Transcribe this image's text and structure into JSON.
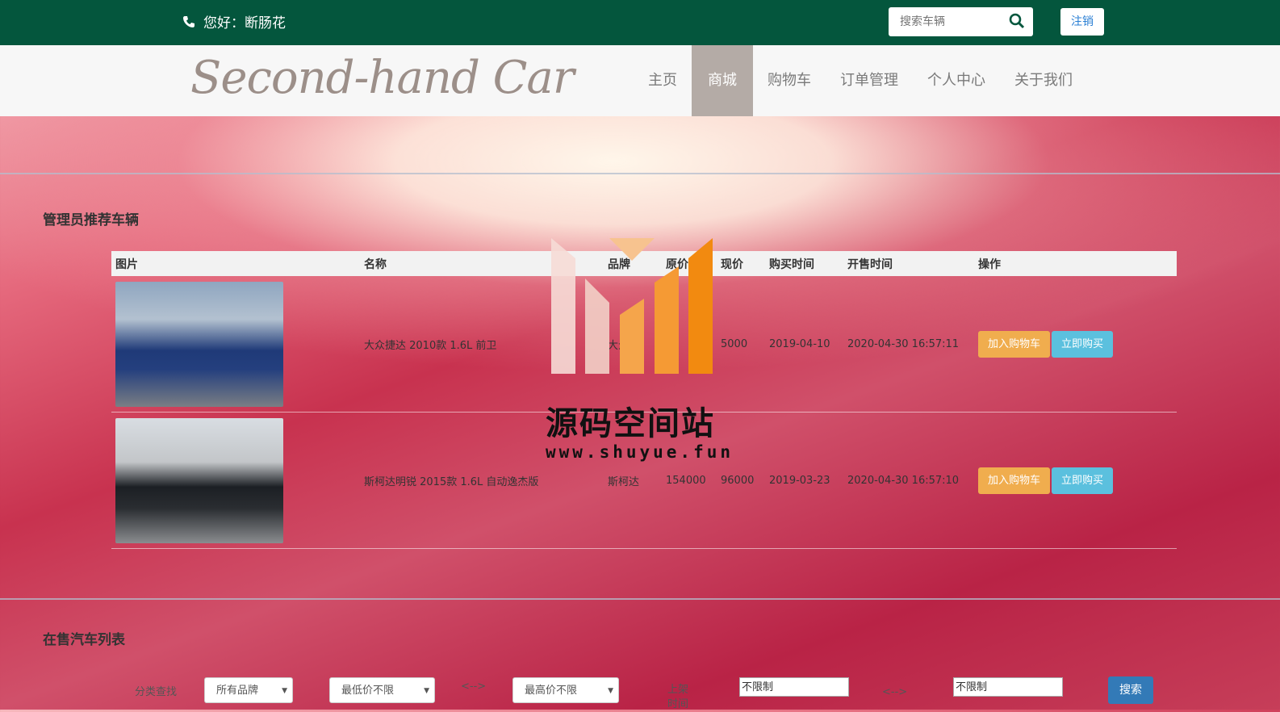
{
  "header": {
    "greeting": "您好：断肠花",
    "search_placeholder": "搜索车辆",
    "logout_label": "注销"
  },
  "navbar": {
    "logo": "Second-hand Car",
    "items": [
      {
        "label": "主页",
        "active": false
      },
      {
        "label": "商城",
        "active": true
      },
      {
        "label": "购物车",
        "active": false
      },
      {
        "label": "订单管理",
        "active": false
      },
      {
        "label": "个人中心",
        "active": false
      },
      {
        "label": "关于我们",
        "active": false
      }
    ]
  },
  "recommend": {
    "title": "管理员推荐车辆",
    "columns": [
      "图片",
      "名称",
      "品牌",
      "原价",
      "现价",
      "购买时间",
      "开售时间",
      "操作"
    ],
    "rows": [
      {
        "name": "大众捷达 2010款 1.6L 前卫",
        "brand": "大众",
        "original_price": "",
        "price": "5000",
        "buy_time": "2019-04-10",
        "sale_time": "2020-04-30 16:57:11",
        "cart_label": "加入购物车",
        "buy_label": "立即购买"
      },
      {
        "name": "斯柯达明锐 2015款 1.6L 自动逸杰版",
        "brand": "斯柯达",
        "original_price": "154000",
        "price": "96000",
        "buy_time": "2019-03-23",
        "sale_time": "2020-04-30 16:57:10",
        "cart_label": "加入购物车",
        "buy_label": "立即购买"
      }
    ]
  },
  "watermark": {
    "text": "源码空间站",
    "url": "www.shuyue.fun"
  },
  "onsale": {
    "title": "在售汽车列表",
    "filter_label": "分类查找",
    "brand_select": "所有品牌",
    "min_price_select": "最低价不限",
    "range_sep": "<-->",
    "max_price_select": "最高价不限",
    "time_label": "上架时间",
    "time_from": "不限制",
    "time_to": "不限制",
    "search_label": "搜索"
  },
  "colors": {
    "topbar": "#04563d",
    "nav_active": "#b4aba6",
    "cart_button": "#f0ad4e",
    "buy_button": "#5bc0de",
    "search_button": "#337ab7"
  }
}
